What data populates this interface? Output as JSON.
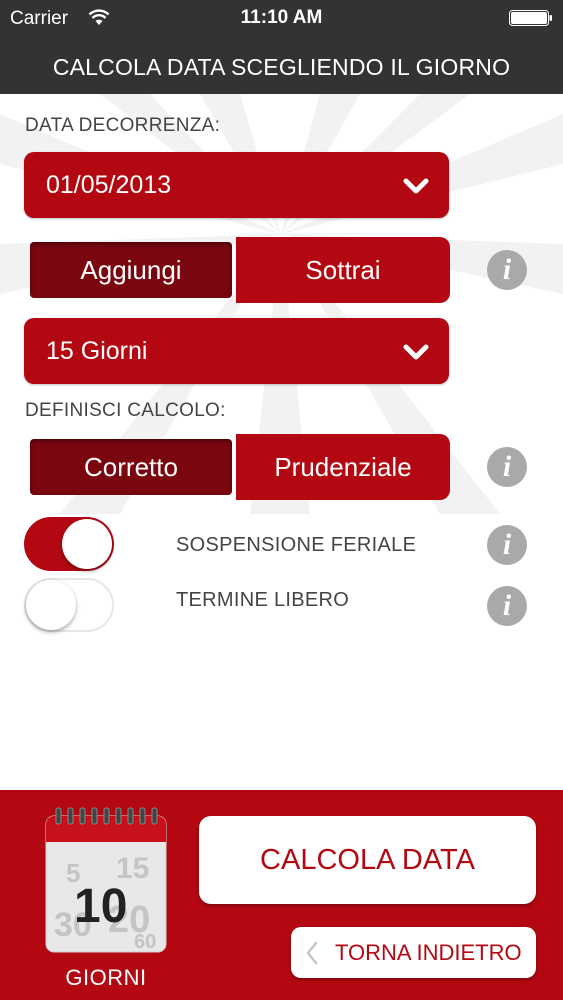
{
  "status_bar": {
    "carrier": "Carrier",
    "time": "11:10 AM"
  },
  "nav_bar": {
    "title": "CALCOLA DATA SCEGLIENDO IL GIORNO"
  },
  "date_section": {
    "label": "DATA DECORRENZA:",
    "value": "01/05/2013"
  },
  "operation": {
    "options": [
      "Aggiungi",
      "Sottrai"
    ],
    "selected": "Aggiungi"
  },
  "days_select": {
    "value": "15 Giorni"
  },
  "calc_section": {
    "label": "DEFINISCI CALCOLO:",
    "options": [
      "Corretto",
      "Prudenziale"
    ],
    "selected": "Corretto"
  },
  "toggles": [
    {
      "label": "SOSPENSIONE FERIALE",
      "on": true
    },
    {
      "label": "TERMINE LIBERO",
      "on": false
    }
  ],
  "info_glyph": "i",
  "footer": {
    "calendar": {
      "big_number": "10",
      "bg_numbers": [
        "5",
        "15",
        "30",
        "20",
        "60"
      ]
    },
    "giorni_label": "GIORNI",
    "calc_button_label": "CALCOLA DATA",
    "back_button_label": "TORNA INDIETRO"
  },
  "colors": {
    "accent": "#b30812",
    "accent_dark": "#7a0610",
    "bar": "#333333",
    "info_gray": "#a9a9a9"
  },
  "icons": [
    "wifi-icon",
    "battery-icon",
    "chevron-down-icon",
    "info-icon",
    "calendar-icon",
    "chevron-left-icon"
  ]
}
